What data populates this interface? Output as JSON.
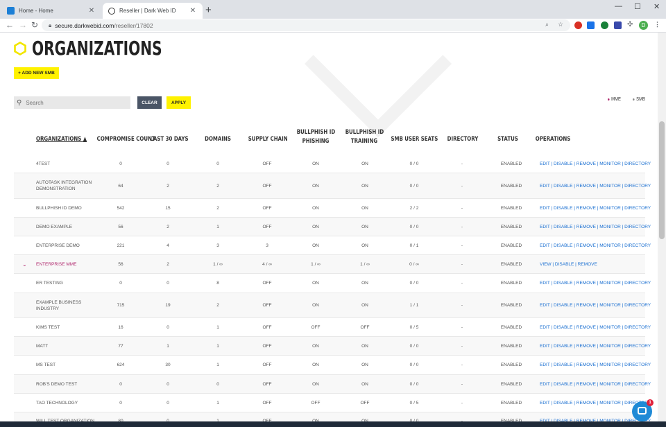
{
  "browser": {
    "tabs": [
      {
        "title": "Home - Home",
        "close": "✕"
      },
      {
        "title": "Reseller | Dark Web ID",
        "close": "✕"
      }
    ],
    "new_tab": "+",
    "window_controls": {
      "minimize": "—",
      "maximize": "☐",
      "close": "✕"
    },
    "url_host": "secure.darkwebid.com",
    "url_path": "/reseller/17802",
    "profile_initial": "D"
  },
  "page": {
    "title": "ORGANIZATIONS",
    "add_button": "+ ADD NEW SMB",
    "search_placeholder": "Search",
    "clear_label": "CLEAR",
    "apply_label": "APPLY",
    "legend": [
      {
        "label": "MME",
        "color": "#b0286e"
      },
      {
        "label": "SMB",
        "color": "#888888"
      }
    ],
    "accent_color": "#fff200"
  },
  "table": {
    "headers": {
      "organizations": "ORGANIZATIONS ▲",
      "compromise": "COMPROMISE COUNT",
      "last30": "LAST 30 DAYS",
      "domains": "DOMAINS",
      "supply": "SUPPLY CHAIN",
      "phishing_1": "BULLPHISH ID",
      "phishing_2": "PHISHING",
      "training_1": "BULLPHISH ID",
      "training_2": "TRAINING",
      "seats": "SMB USER SEATS",
      "directory": "DIRECTORY",
      "status": "STATUS",
      "operations": "OPERATIONS"
    },
    "rows": [
      {
        "name": "4TEST",
        "compromise": "0",
        "last30": "0",
        "domains": "0",
        "supply": "OFF",
        "phishing": "ON",
        "training": "ON",
        "seats": "0 / 0",
        "directory": "-",
        "status": "ENABLED",
        "ops": "EDIT | DISABLE | REMOVE | MONITOR | DIRECTORY"
      },
      {
        "name": "AUTOTASK INTEGRATION DEMONSTRATION",
        "compromise": "64",
        "last30": "2",
        "domains": "2",
        "supply": "OFF",
        "phishing": "ON",
        "training": "ON",
        "seats": "0 / 0",
        "directory": "-",
        "status": "ENABLED",
        "ops": "EDIT | DISABLE | REMOVE | MONITOR | DIRECTORY"
      },
      {
        "name": "BULLPHISH ID DEMO",
        "compromise": "542",
        "last30": "15",
        "domains": "2",
        "supply": "OFF",
        "phishing": "ON",
        "training": "ON",
        "seats": "2 / 2",
        "directory": "-",
        "status": "ENABLED",
        "ops": "EDIT | DISABLE | REMOVE | MONITOR | DIRECTORY"
      },
      {
        "name": "DEMO EXAMPLE",
        "compromise": "56",
        "last30": "2",
        "domains": "1",
        "supply": "OFF",
        "phishing": "ON",
        "training": "ON",
        "seats": "0 / 0",
        "directory": "-",
        "status": "ENABLED",
        "ops": "EDIT | DISABLE | REMOVE | MONITOR | DIRECTORY"
      },
      {
        "name": "ENTERPRISE DEMO",
        "compromise": "221",
        "last30": "4",
        "domains": "3",
        "supply": "3",
        "phishing": "ON",
        "training": "ON",
        "seats": "0 / 1",
        "directory": "-",
        "status": "ENABLED",
        "ops": "EDIT | DISABLE | REMOVE | MONITOR | DIRECTORY"
      },
      {
        "name": "ENTERPRISE MME",
        "mme": true,
        "compromise": "56",
        "last30": "2",
        "domains": "1 / ∞",
        "supply": "4 / ∞",
        "phishing": "1 / ∞",
        "training": "1 / ∞",
        "seats": "0 / ∞",
        "directory": "-",
        "status": "ENABLED",
        "ops": "VIEW | DISABLE | REMOVE"
      },
      {
        "name": "ER TESTING",
        "compromise": "0",
        "last30": "0",
        "domains": "8",
        "supply": "OFF",
        "phishing": "ON",
        "training": "ON",
        "seats": "0 / 0",
        "directory": "-",
        "status": "ENABLED",
        "ops": "EDIT | DISABLE | REMOVE | MONITOR | DIRECTORY"
      },
      {
        "name": "EXAMPLE BUSINESS INDUSTRY",
        "compromise": "715",
        "last30": "19",
        "domains": "2",
        "supply": "OFF",
        "phishing": "ON",
        "training": "ON",
        "seats": "1 / 1",
        "directory": "-",
        "status": "ENABLED",
        "ops": "EDIT | DISABLE | REMOVE | MONITOR | DIRECTORY"
      },
      {
        "name": "KIMS TEST",
        "compromise": "16",
        "last30": "0",
        "domains": "1",
        "supply": "OFF",
        "phishing": "OFF",
        "training": "OFF",
        "seats": "0 / 5",
        "directory": "-",
        "status": "ENABLED",
        "ops": "EDIT | DISABLE | REMOVE | MONITOR | DIRECTORY"
      },
      {
        "name": "MATT",
        "compromise": "77",
        "last30": "1",
        "domains": "1",
        "supply": "OFF",
        "phishing": "ON",
        "training": "ON",
        "seats": "0 / 0",
        "directory": "-",
        "status": "ENABLED",
        "ops": "EDIT | DISABLE | REMOVE | MONITOR | DIRECTORY"
      },
      {
        "name": "MS TEST",
        "compromise": "624",
        "last30": "30",
        "domains": "1",
        "supply": "OFF",
        "phishing": "ON",
        "training": "ON",
        "seats": "0 / 0",
        "directory": "-",
        "status": "ENABLED",
        "ops": "EDIT | DISABLE | REMOVE | MONITOR | DIRECTORY"
      },
      {
        "name": "ROB'S DEMO TEST",
        "compromise": "0",
        "last30": "0",
        "domains": "0",
        "supply": "OFF",
        "phishing": "ON",
        "training": "ON",
        "seats": "0 / 0",
        "directory": "-",
        "status": "ENABLED",
        "ops": "EDIT | DISABLE | REMOVE | MONITOR | DIRECTORY"
      },
      {
        "name": "TAO TECHNOLOGY",
        "compromise": "0",
        "last30": "0",
        "domains": "1",
        "supply": "OFF",
        "phishing": "OFF",
        "training": "OFF",
        "seats": "0 / 5",
        "directory": "-",
        "status": "ENABLED",
        "ops": "EDIT | DISABLE | REMOVE | MONITOR | DIRECTORY"
      },
      {
        "name": "WILL TEST ORGANIZATION",
        "compromise": "80",
        "last30": "0",
        "domains": "1",
        "supply": "OFF",
        "phishing": "ON",
        "training": "ON",
        "seats": "0 / 0",
        "directory": "-",
        "status": "ENABLED",
        "ops": "EDIT | DISABLE | REMOVE | MONITOR | DIRECTORY"
      }
    ]
  },
  "chat": {
    "badge": "1"
  }
}
